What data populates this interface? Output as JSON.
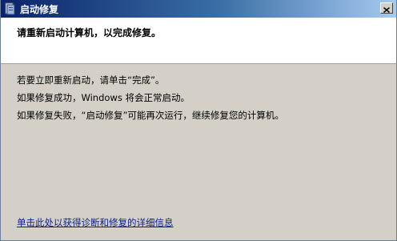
{
  "window": {
    "title": "启动修复",
    "title_icon": "startup-repair-icon",
    "close_icon": "close-icon"
  },
  "header": {
    "text": "请重新启动计算机，以完成修复。"
  },
  "body": {
    "lines": [
      "若要立即重新启动，请单击“完成”。",
      "如果修复成功，Windows 将会正常启动。",
      "如果修复失败，“启动修复”可能再次运行，继续修复您的计算机。"
    ],
    "details_link": "单击此处以获得诊断和修复的详细信息"
  },
  "colors": {
    "titlebar_start": "#0a246a",
    "titlebar_end": "#a6caf0",
    "panel_bg": "#d4d0c8",
    "link": "#0a1e8c"
  }
}
